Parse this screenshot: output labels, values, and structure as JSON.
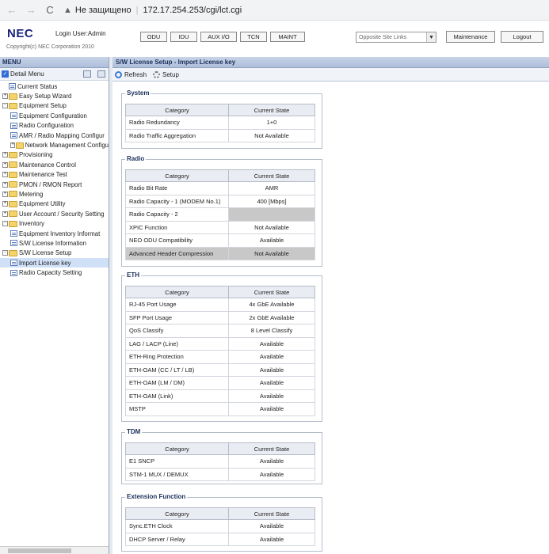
{
  "browser": {
    "back_icon": "←",
    "forward_icon": "→",
    "reload_icon": "C",
    "security_label": "Не защищено",
    "url": "172.17.254.253/cgi/lct.cgi"
  },
  "header": {
    "logo": "NEC",
    "login_user": "Login User:Admin",
    "copyright": "Copyright(c) NEC Corporation 2010",
    "nav": {
      "odu": "ODU",
      "idu": "IDU",
      "aux": "AUX I/O",
      "tcn": "TCN",
      "maint": "MAINT"
    },
    "site_select": "Opposite Site Links",
    "maintenance": "Maintenance",
    "logout": "Logout"
  },
  "sidebar": {
    "title": "MENU",
    "detail_menu": "Detail Menu",
    "items": [
      {
        "label": "Current Status",
        "depth": 0,
        "kind": "page"
      },
      {
        "label": "Easy Setup Wizard",
        "depth": 0,
        "kind": "folder",
        "exp": "+"
      },
      {
        "label": "Equipment Setup",
        "depth": 0,
        "kind": "folder",
        "exp": "-"
      },
      {
        "label": "Equipment Configuration",
        "depth": 1,
        "kind": "page"
      },
      {
        "label": "Radio Configuration",
        "depth": 1,
        "kind": "page"
      },
      {
        "label": "AMR / Radio Mapping Configur",
        "depth": 1,
        "kind": "page"
      },
      {
        "label": "Network Management Configu",
        "depth": 1,
        "kind": "folder",
        "exp": "+"
      },
      {
        "label": "Provisioning",
        "depth": 0,
        "kind": "folder",
        "exp": "+"
      },
      {
        "label": "Maintenance Control",
        "depth": 0,
        "kind": "folder",
        "exp": "+"
      },
      {
        "label": "Maintenance Test",
        "depth": 0,
        "kind": "folder",
        "exp": "+"
      },
      {
        "label": "PMON / RMON Report",
        "depth": 0,
        "kind": "folder",
        "exp": "+"
      },
      {
        "label": "Metering",
        "depth": 0,
        "kind": "folder",
        "exp": "+"
      },
      {
        "label": "Equipment Utility",
        "depth": 0,
        "kind": "folder",
        "exp": "+"
      },
      {
        "label": "User Account / Security Setting",
        "depth": 0,
        "kind": "folder",
        "exp": "+"
      },
      {
        "label": "Inventory",
        "depth": 0,
        "kind": "folder",
        "exp": "-"
      },
      {
        "label": "Equipment Inventory Informat",
        "depth": 1,
        "kind": "page"
      },
      {
        "label": "S/W License Information",
        "depth": 1,
        "kind": "page"
      },
      {
        "label": "S/W License Setup",
        "depth": 0,
        "kind": "folder",
        "exp": "-"
      },
      {
        "label": "Import License key",
        "depth": 1,
        "kind": "page",
        "selected": true
      },
      {
        "label": "Radio Capacity Setting",
        "depth": 1,
        "kind": "page"
      }
    ]
  },
  "content": {
    "title": "S/W License Setup - Import License key",
    "toolbar": {
      "refresh": "Refresh",
      "setup": "Setup"
    },
    "col_category": "Category",
    "col_state": "Current State",
    "sections": [
      {
        "name": "System",
        "rows": [
          {
            "category": "Radio Redundancy",
            "state": "1+0"
          },
          {
            "category": "Radio Traffic Aggregation",
            "state": "Not Available"
          }
        ]
      },
      {
        "name": "Radio",
        "rows": [
          {
            "category": "Radio Bit Rate",
            "state": "AMR"
          },
          {
            "category": "Radio Capacity - 1 (MODEM No.1)",
            "state": "400 [Mbps]"
          },
          {
            "category": "Radio Capacity - 2",
            "state": ""
          },
          {
            "category": "XPIC Function",
            "state": "Not Available"
          },
          {
            "category": "NEO ODU Compatibility",
            "state": "Available"
          },
          {
            "category": "Advanced Header Compression",
            "state": "Not Available"
          }
        ]
      },
      {
        "name": "ETH",
        "rows": [
          {
            "category": "RJ-45 Port Usage",
            "state": "4x GbE Available"
          },
          {
            "category": "SFP Port Usage",
            "state": "2x GbE Available"
          },
          {
            "category": "QoS Classify",
            "state": "8 Level Classify"
          },
          {
            "category": "LAG / LACP (Line)",
            "state": "Available"
          },
          {
            "category": "ETH-Ring Protection",
            "state": "Available"
          },
          {
            "category": "ETH-OAM (CC / LT / LB)",
            "state": "Available"
          },
          {
            "category": "ETH-OAM (LM / DM)",
            "state": "Available"
          },
          {
            "category": "ETH-OAM (Link)",
            "state": "Available"
          },
          {
            "category": "MSTP",
            "state": "Available"
          }
        ]
      },
      {
        "name": "TDM",
        "rows": [
          {
            "category": "E1 SNCP",
            "state": "Available"
          },
          {
            "category": "STM-1 MUX / DEMUX",
            "state": "Available"
          }
        ]
      },
      {
        "name": "Extension Function",
        "rows": [
          {
            "category": "Sync.ETH Clock",
            "state": "Available"
          },
          {
            "category": "DHCP Server / Relay",
            "state": "Available"
          }
        ]
      }
    ]
  }
}
